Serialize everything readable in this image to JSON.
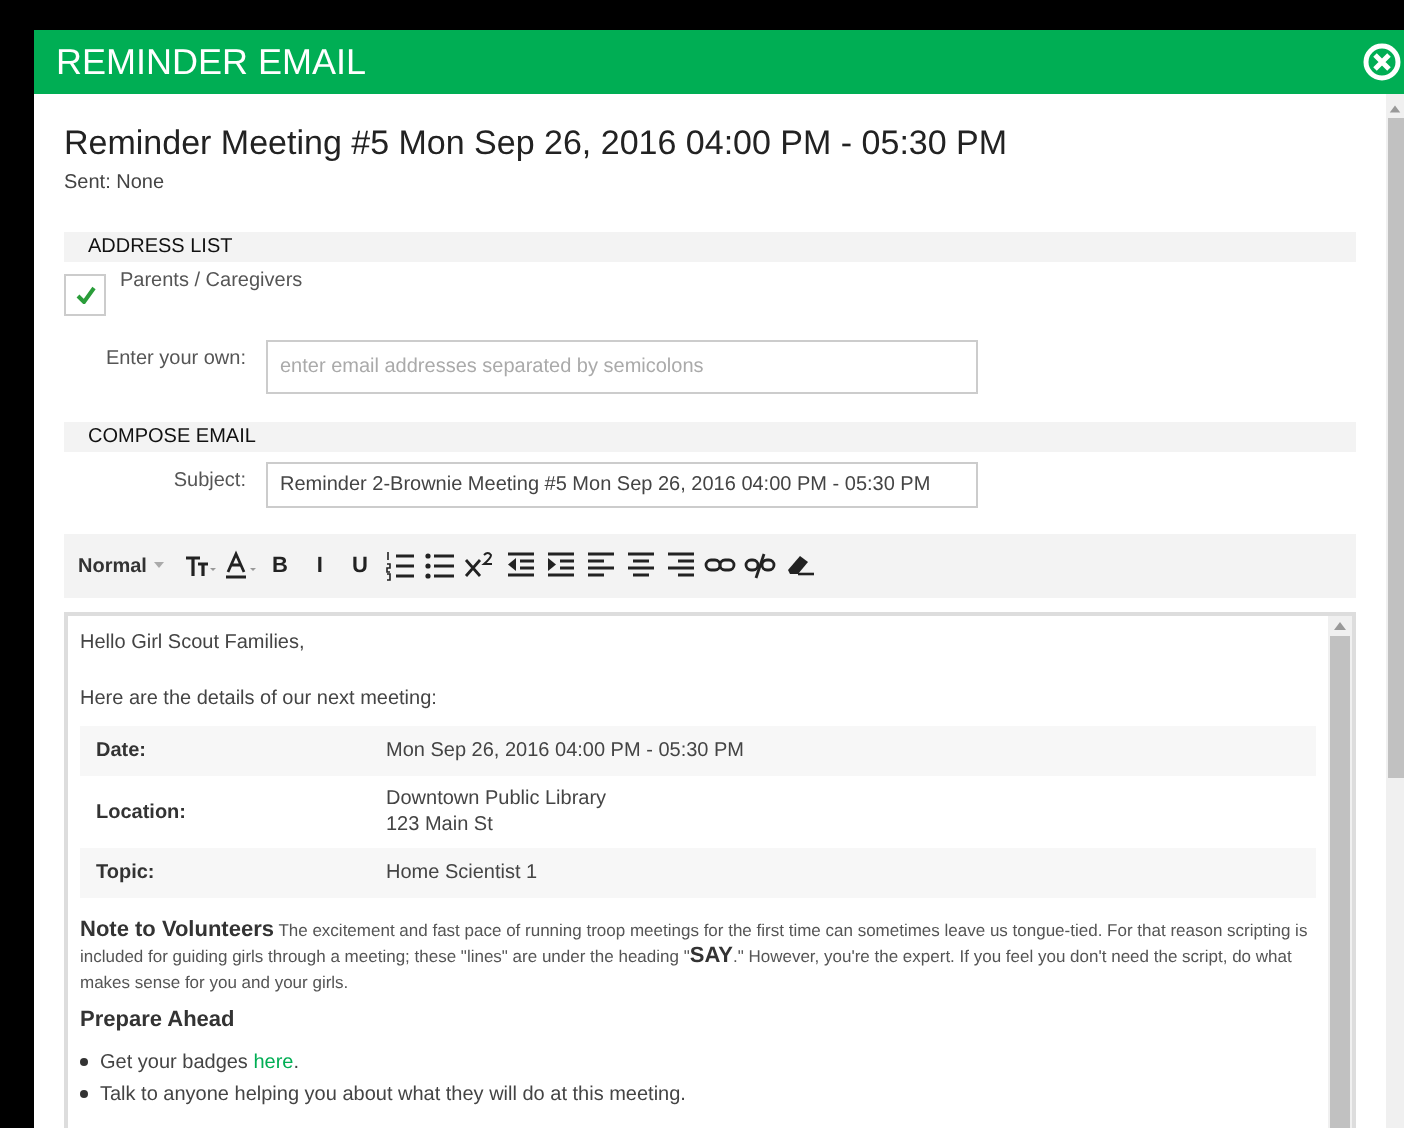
{
  "dialog": {
    "title": "REMINDER EMAIL"
  },
  "heading": "Reminder Meeting #5 Mon Sep 26, 2016 04:00 PM - 05:30 PM",
  "sent": "Sent: None",
  "address_list": {
    "header": "ADDRESS LIST",
    "recipients": [
      {
        "label": "Parents / Caregivers",
        "checked": true
      }
    ],
    "own": {
      "label": "Enter your own:",
      "placeholder": "enter email addresses separated by semicolons"
    }
  },
  "compose": {
    "header": "COMPOSE EMAIL",
    "subject_label": "Subject:",
    "subject": "Reminder 2-Brownie Meeting #5 Mon Sep 26, 2016 04:00 PM - 05:30 PM"
  },
  "toolbar": [
    {
      "kind": "format",
      "label": "Normal"
    },
    {
      "kind": "size"
    },
    {
      "kind": "color"
    },
    {
      "kind": "char",
      "label": "B"
    },
    {
      "kind": "char",
      "label": "I"
    },
    {
      "kind": "char",
      "label": "U"
    },
    {
      "kind": "ol"
    },
    {
      "kind": "ul"
    },
    {
      "kind": "sup"
    },
    {
      "kind": "outdent"
    },
    {
      "kind": "indent"
    },
    {
      "kind": "left"
    },
    {
      "kind": "center"
    },
    {
      "kind": "right"
    },
    {
      "kind": "link"
    },
    {
      "kind": "unlink"
    },
    {
      "kind": "eraser"
    }
  ],
  "body": {
    "greeting": "Hello Girl Scout Families,",
    "intro": "Here are the details of our next meeting:",
    "details": [
      {
        "label": "Date:",
        "lines": [
          "Mon Sep 26, 2016 04:00 PM - 05:30 PM"
        ]
      },
      {
        "label": "Location:",
        "lines": [
          "Downtown Public Library",
          "123 Main St"
        ]
      },
      {
        "label": "Topic:",
        "lines": [
          "Home Scientist 1"
        ]
      }
    ],
    "note": "**Note to Volunteers** The excitement and fast pace of running troop meetings for the first time can sometimes leave us tongue-tied. For that reason scripting is included for guiding girls through a meeting; these \"lines\" are under the heading \"**SAY**.\" However, you're the expert. If you feel you don't need the script, do what makes sense for you and your girls.",
    "prepare_heading": "Prepare Ahead",
    "bullets": [
      {
        "text": "Get your badges ",
        "link": "here",
        "after": "."
      },
      {
        "text": "Talk to anyone helping you about what they will do at this meeting."
      }
    ]
  }
}
